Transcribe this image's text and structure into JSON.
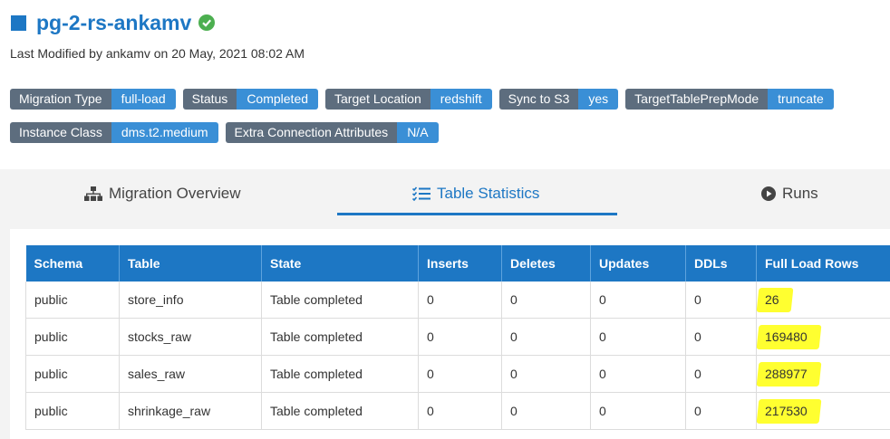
{
  "header": {
    "title": "pg-2-rs-ankamv",
    "last_modified": "Last Modified by ankamv on 20 May, 2021 08:02 AM"
  },
  "badges": {
    "row1": [
      {
        "key": "Migration Type",
        "value": "full-load"
      },
      {
        "key": "Status",
        "value": "Completed"
      },
      {
        "key": "Target Location",
        "value": "redshift"
      },
      {
        "key": "Sync to S3",
        "value": "yes"
      },
      {
        "key": "TargetTablePrepMode",
        "value": "truncate"
      }
    ],
    "row2": [
      {
        "key": "Instance Class",
        "value": "dms.t2.medium"
      },
      {
        "key": "Extra Connection Attributes",
        "value": "N/A"
      }
    ]
  },
  "tabs": [
    {
      "label": "Migration Overview",
      "icon": "sitemap-icon"
    },
    {
      "label": "Table Statistics",
      "icon": "list-check-icon",
      "active": true
    },
    {
      "label": "Runs",
      "icon": "play-circle-icon"
    }
  ],
  "table": {
    "headers": [
      "Schema",
      "Table",
      "State",
      "Inserts",
      "Deletes",
      "Updates",
      "DDLs",
      "Full Load Rows"
    ],
    "rows": [
      [
        "public",
        "store_info",
        "Table completed",
        "0",
        "0",
        "0",
        "0",
        "26"
      ],
      [
        "public",
        "stocks_raw",
        "Table completed",
        "0",
        "0",
        "0",
        "0",
        "169480"
      ],
      [
        "public",
        "sales_raw",
        "Table completed",
        "0",
        "0",
        "0",
        "0",
        "288977"
      ],
      [
        "public",
        "shrinkage_raw",
        "Table completed",
        "0",
        "0",
        "0",
        "0",
        "217530"
      ]
    ]
  },
  "colors": {
    "accent": "#1d77c4",
    "badge_key": "#5d6d7e",
    "badge_value": "#3a8fd6",
    "highlight": "#ffff30",
    "success": "#4caf50"
  }
}
